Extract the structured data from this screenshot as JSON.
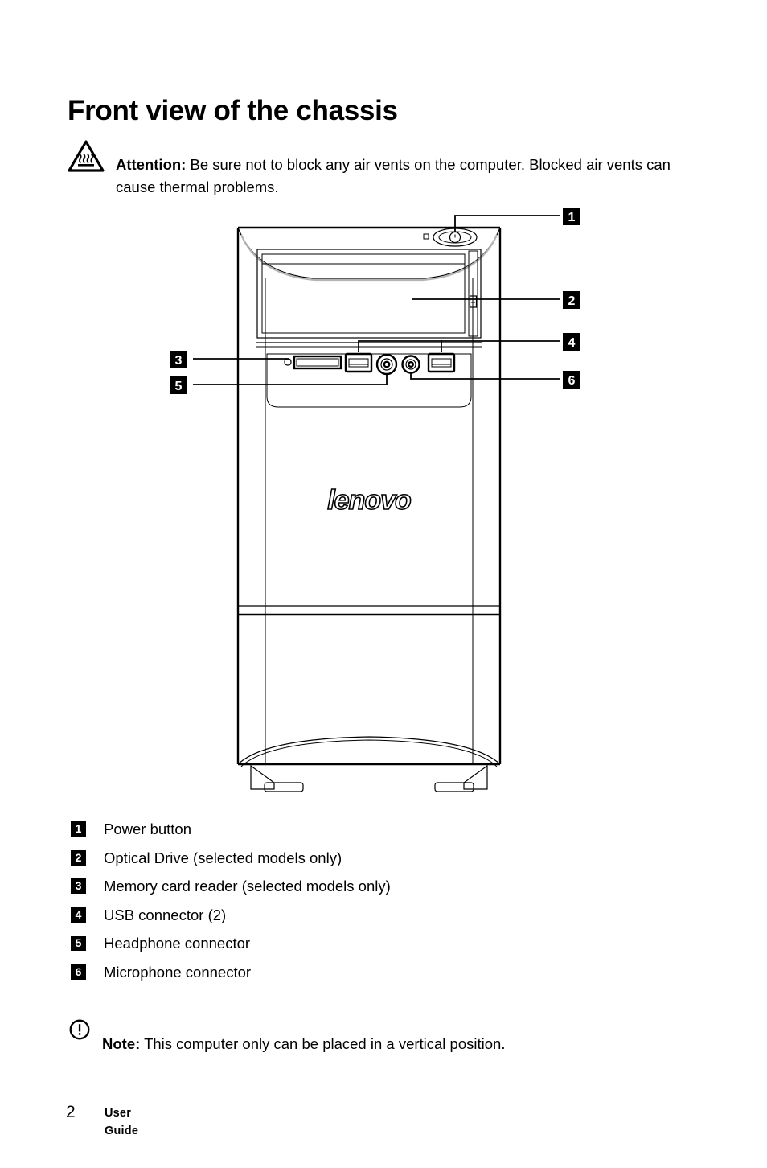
{
  "page": {
    "title": "Front view of the chassis"
  },
  "attention": {
    "icon": "hot-surface-warning-icon",
    "label": "Attention:",
    "text": " Be sure not to block any air vents on the computer. Blocked air vents can cause thermal problems."
  },
  "figure": {
    "name": "front-view-of-chassis-illustration",
    "brand_logo": "lenovo",
    "callouts": [
      {
        "number": "1",
        "target": "power-button",
        "side": "right"
      },
      {
        "number": "2",
        "target": "optical-drive",
        "side": "right"
      },
      {
        "number": "3",
        "target": "memory-card-reader",
        "side": "left"
      },
      {
        "number": "4",
        "target": "usb-connector",
        "side": "right"
      },
      {
        "number": "5",
        "target": "headphone-connector",
        "side": "left"
      },
      {
        "number": "6",
        "target": "microphone-connector",
        "side": "right"
      }
    ]
  },
  "legend": {
    "items": [
      {
        "number": "1",
        "label": "Power button"
      },
      {
        "number": "2",
        "label": "Optical Drive (selected models only)"
      },
      {
        "number": "3",
        "label": "Memory card reader (selected models only)"
      },
      {
        "number": "4",
        "label": "USB connector (2)"
      },
      {
        "number": "5",
        "label": "Headphone connector"
      },
      {
        "number": "6",
        "label": "Microphone connector"
      }
    ]
  },
  "note": {
    "icon": "exclamation-circle-icon",
    "label": "Note:",
    "text": " This computer only can be placed in a vertical position."
  },
  "footer": {
    "page_number": "2",
    "document_title": "User Guide"
  },
  "colors": {
    "ink": "#000000",
    "paper": "#ffffff",
    "line": "#1a1a1a",
    "shade": "#b8b8b8"
  }
}
